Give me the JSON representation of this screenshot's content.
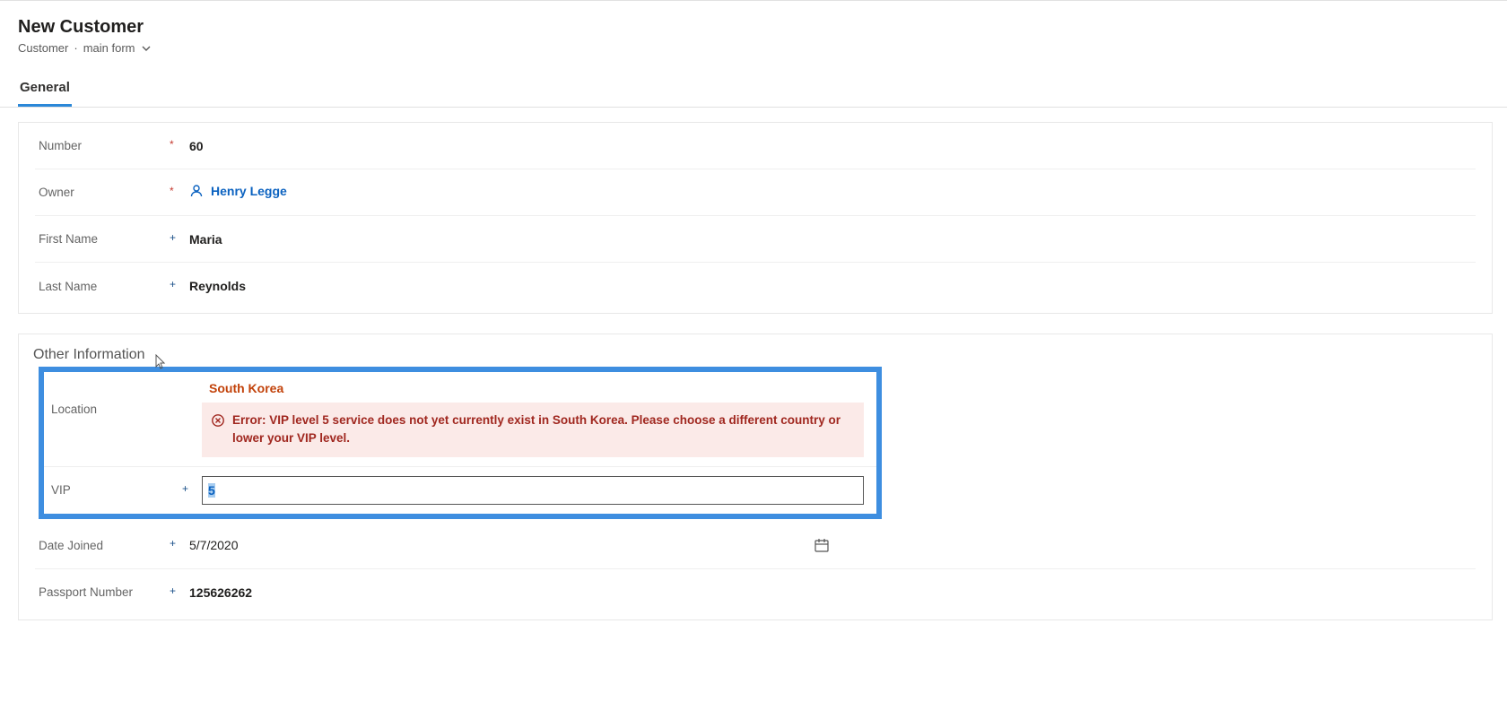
{
  "header": {
    "title": "New Customer",
    "breadcrumb_entity": "Customer",
    "breadcrumb_form": "main form"
  },
  "tabs": {
    "general": "General"
  },
  "general": {
    "number_label": "Number",
    "number_value": "60",
    "owner_label": "Owner",
    "owner_value": "Henry Legge",
    "first_name_label": "First Name",
    "first_name_value": "Maria",
    "last_name_label": "Last Name",
    "last_name_value": "Reynolds"
  },
  "other": {
    "section_title": "Other Information",
    "location_label": "Location",
    "location_value": "South Korea",
    "location_error": "Error: VIP level 5 service does not yet currently exist in South Korea. Please choose a different country or lower your VIP level.",
    "vip_label": "VIP",
    "vip_value": "5",
    "date_joined_label": "Date Joined",
    "date_joined_value": "5/7/2020",
    "passport_label": "Passport Number",
    "passport_value": "125626262"
  }
}
